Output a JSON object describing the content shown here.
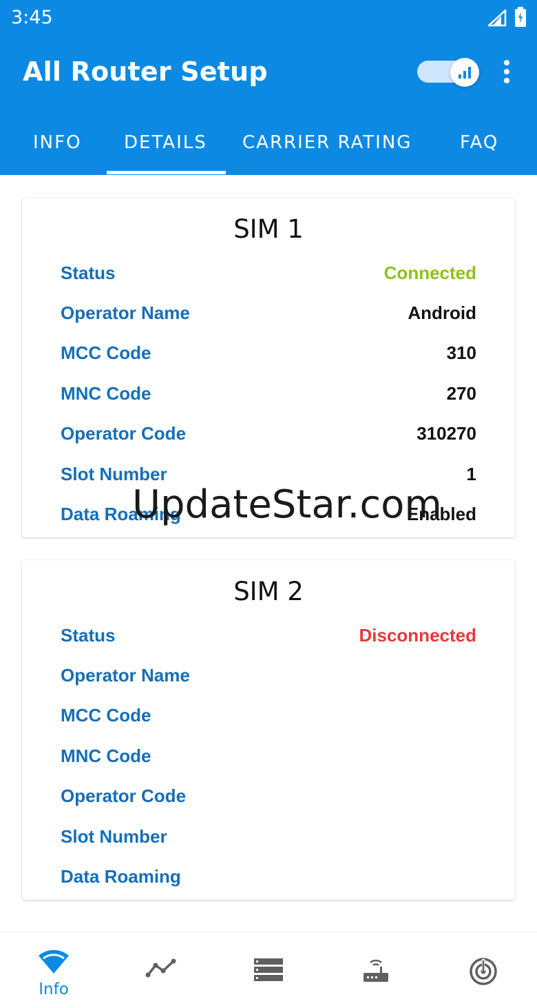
{
  "status_bar": {
    "time": "3:45"
  },
  "app_bar": {
    "title": "All Router Setup"
  },
  "tabs": [
    {
      "label": "INFO",
      "selected": false
    },
    {
      "label": "DETAILS",
      "selected": true
    },
    {
      "label": "CARRIER RATING",
      "selected": false
    },
    {
      "label": "FAQ",
      "selected": false
    }
  ],
  "sim1": {
    "title": "SIM 1",
    "rows": [
      {
        "label": "Status",
        "value": "Connected"
      },
      {
        "label": "Operator Name",
        "value": "Android"
      },
      {
        "label": "MCC Code",
        "value": "310"
      },
      {
        "label": "MNC Code",
        "value": "270"
      },
      {
        "label": "Operator Code",
        "value": "310270"
      },
      {
        "label": "Slot Number",
        "value": "1"
      },
      {
        "label": "Data Roaming",
        "value": "Enabled"
      }
    ]
  },
  "sim2": {
    "title": "SIM 2",
    "rows": [
      {
        "label": "Status",
        "value": "Disconnected"
      },
      {
        "label": "Operator Name",
        "value": ""
      },
      {
        "label": "MCC Code",
        "value": ""
      },
      {
        "label": "MNC Code",
        "value": ""
      },
      {
        "label": "Operator Code",
        "value": ""
      },
      {
        "label": "Slot Number",
        "value": ""
      },
      {
        "label": "Data Roaming",
        "value": ""
      }
    ]
  },
  "watermark": "UpdateStar.com",
  "bottom_nav": [
    {
      "icon": "wifi-icon",
      "label": "Info",
      "active": true
    },
    {
      "icon": "trend-chart-icon",
      "active": false
    },
    {
      "icon": "list-icon",
      "active": false
    },
    {
      "icon": "router-icon",
      "active": false
    },
    {
      "icon": "radar-icon",
      "active": false
    }
  ],
  "colors": {
    "primary": "#0c8ae3",
    "label": "#156eb8",
    "connected": "#8cc21b",
    "disconnected": "#e53939",
    "nav_inactive": "#5f5f5f"
  }
}
